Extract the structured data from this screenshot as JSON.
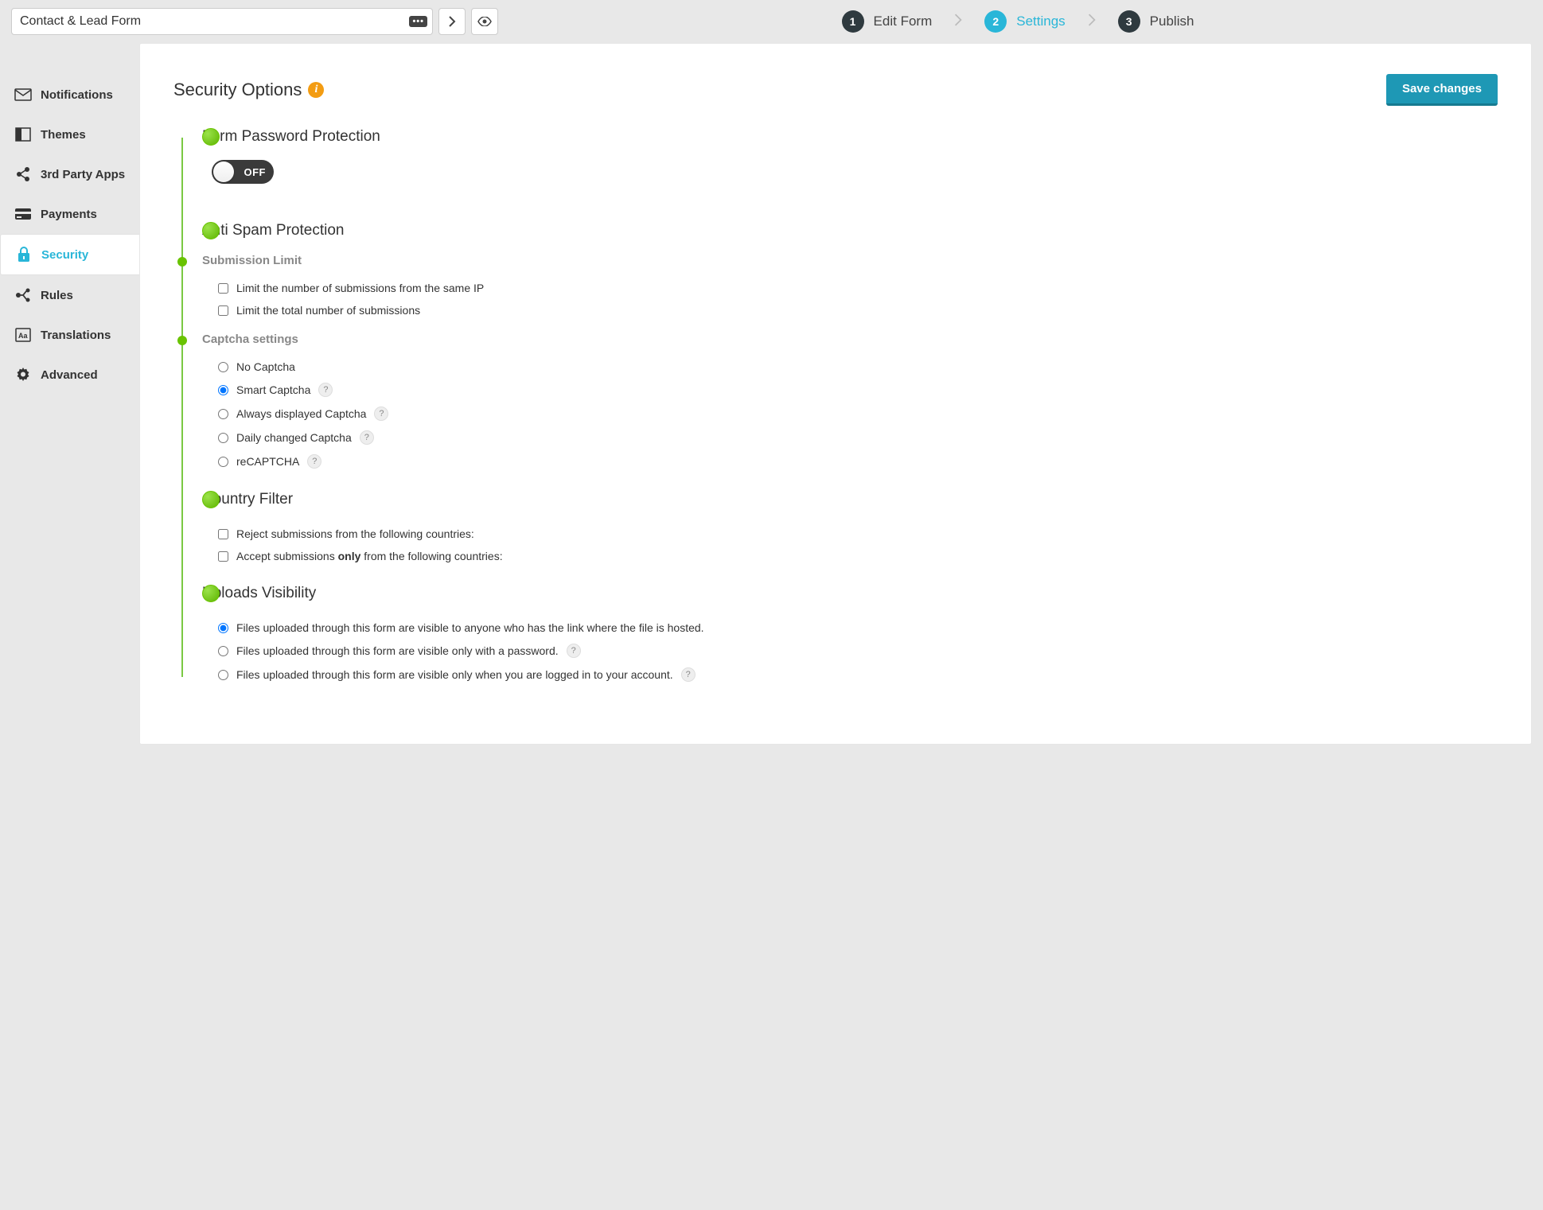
{
  "form_name": "Contact & Lead Form",
  "wizard": {
    "steps": [
      {
        "num": "1",
        "label": "Edit Form"
      },
      {
        "num": "2",
        "label": "Settings"
      },
      {
        "num": "3",
        "label": "Publish"
      }
    ],
    "active_index": 1
  },
  "sidebar": {
    "items": [
      {
        "label": "Notifications",
        "icon": "mail"
      },
      {
        "label": "Themes",
        "icon": "layout"
      },
      {
        "label": "3rd Party Apps",
        "icon": "share"
      },
      {
        "label": "Payments",
        "icon": "card"
      },
      {
        "label": "Security",
        "icon": "lock"
      },
      {
        "label": "Rules",
        "icon": "branch"
      },
      {
        "label": "Translations",
        "icon": "lang"
      },
      {
        "label": "Advanced",
        "icon": "gear"
      }
    ],
    "active_index": 4
  },
  "page": {
    "title": "Security Options",
    "save_button": "Save changes"
  },
  "password_protection": {
    "heading": "Form Password Protection",
    "toggle_state": "OFF"
  },
  "anti_spam": {
    "heading": "Anti Spam Protection",
    "submission_limit": {
      "heading": "Submission Limit",
      "opts": [
        {
          "label": "Limit the number of submissions from the same IP",
          "checked": false
        },
        {
          "label": "Limit the total number of submissions",
          "checked": false
        }
      ]
    },
    "captcha": {
      "heading": "Captcha settings",
      "opts": [
        {
          "label": "No Captcha",
          "help": false,
          "selected": false
        },
        {
          "label": "Smart Captcha",
          "help": true,
          "selected": true
        },
        {
          "label": "Always displayed Captcha",
          "help": true,
          "selected": false
        },
        {
          "label": "Daily changed Captcha",
          "help": true,
          "selected": false
        },
        {
          "label": "reCAPTCHA",
          "help": true,
          "selected": false
        }
      ]
    }
  },
  "country_filter": {
    "heading": "Country Filter",
    "opts": [
      {
        "prefix": "Reject submissions from the following countries:",
        "bold": "",
        "suffix": "",
        "checked": false
      },
      {
        "prefix": "Accept submissions ",
        "bold": "only",
        "suffix": " from the following countries:",
        "checked": false
      }
    ]
  },
  "uploads": {
    "heading": "Uploads Visibility",
    "opts": [
      {
        "label": "Files uploaded through this form are visible to anyone who has the link where the file is hosted.",
        "help": false,
        "selected": true
      },
      {
        "label": "Files uploaded through this form are visible only with a password.",
        "help": true,
        "selected": false
      },
      {
        "label": "Files uploaded through this form are visible only when you are logged in to your account.",
        "help": true,
        "selected": false
      }
    ]
  }
}
